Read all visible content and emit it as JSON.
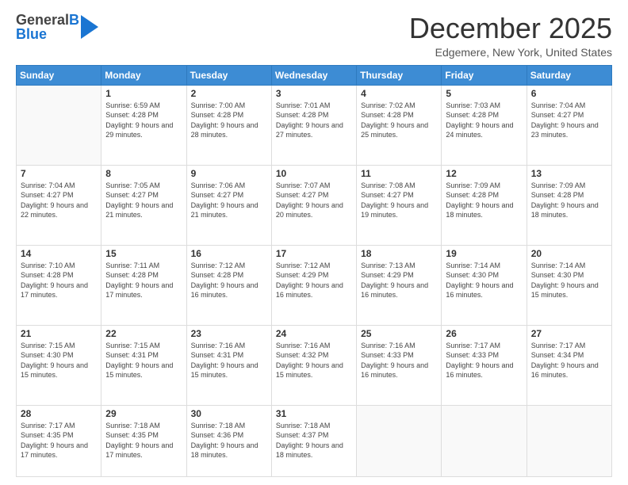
{
  "header": {
    "logo_line1_general": "General",
    "logo_line1_b": "B",
    "logo_line2": "Blue",
    "title": "December 2025",
    "subtitle": "Edgemere, New York, United States"
  },
  "calendar": {
    "days_of_week": [
      "Sunday",
      "Monday",
      "Tuesday",
      "Wednesday",
      "Thursday",
      "Friday",
      "Saturday"
    ],
    "weeks": [
      [
        {
          "day": "",
          "sunrise": "",
          "sunset": "",
          "daylight": ""
        },
        {
          "day": "1",
          "sunrise": "Sunrise: 6:59 AM",
          "sunset": "Sunset: 4:28 PM",
          "daylight": "Daylight: 9 hours and 29 minutes."
        },
        {
          "day": "2",
          "sunrise": "Sunrise: 7:00 AM",
          "sunset": "Sunset: 4:28 PM",
          "daylight": "Daylight: 9 hours and 28 minutes."
        },
        {
          "day": "3",
          "sunrise": "Sunrise: 7:01 AM",
          "sunset": "Sunset: 4:28 PM",
          "daylight": "Daylight: 9 hours and 27 minutes."
        },
        {
          "day": "4",
          "sunrise": "Sunrise: 7:02 AM",
          "sunset": "Sunset: 4:28 PM",
          "daylight": "Daylight: 9 hours and 25 minutes."
        },
        {
          "day": "5",
          "sunrise": "Sunrise: 7:03 AM",
          "sunset": "Sunset: 4:28 PM",
          "daylight": "Daylight: 9 hours and 24 minutes."
        },
        {
          "day": "6",
          "sunrise": "Sunrise: 7:04 AM",
          "sunset": "Sunset: 4:27 PM",
          "daylight": "Daylight: 9 hours and 23 minutes."
        }
      ],
      [
        {
          "day": "7",
          "sunrise": "Sunrise: 7:04 AM",
          "sunset": "Sunset: 4:27 PM",
          "daylight": "Daylight: 9 hours and 22 minutes."
        },
        {
          "day": "8",
          "sunrise": "Sunrise: 7:05 AM",
          "sunset": "Sunset: 4:27 PM",
          "daylight": "Daylight: 9 hours and 21 minutes."
        },
        {
          "day": "9",
          "sunrise": "Sunrise: 7:06 AM",
          "sunset": "Sunset: 4:27 PM",
          "daylight": "Daylight: 9 hours and 21 minutes."
        },
        {
          "day": "10",
          "sunrise": "Sunrise: 7:07 AM",
          "sunset": "Sunset: 4:27 PM",
          "daylight": "Daylight: 9 hours and 20 minutes."
        },
        {
          "day": "11",
          "sunrise": "Sunrise: 7:08 AM",
          "sunset": "Sunset: 4:27 PM",
          "daylight": "Daylight: 9 hours and 19 minutes."
        },
        {
          "day": "12",
          "sunrise": "Sunrise: 7:09 AM",
          "sunset": "Sunset: 4:28 PM",
          "daylight": "Daylight: 9 hours and 18 minutes."
        },
        {
          "day": "13",
          "sunrise": "Sunrise: 7:09 AM",
          "sunset": "Sunset: 4:28 PM",
          "daylight": "Daylight: 9 hours and 18 minutes."
        }
      ],
      [
        {
          "day": "14",
          "sunrise": "Sunrise: 7:10 AM",
          "sunset": "Sunset: 4:28 PM",
          "daylight": "Daylight: 9 hours and 17 minutes."
        },
        {
          "day": "15",
          "sunrise": "Sunrise: 7:11 AM",
          "sunset": "Sunset: 4:28 PM",
          "daylight": "Daylight: 9 hours and 17 minutes."
        },
        {
          "day": "16",
          "sunrise": "Sunrise: 7:12 AM",
          "sunset": "Sunset: 4:28 PM",
          "daylight": "Daylight: 9 hours and 16 minutes."
        },
        {
          "day": "17",
          "sunrise": "Sunrise: 7:12 AM",
          "sunset": "Sunset: 4:29 PM",
          "daylight": "Daylight: 9 hours and 16 minutes."
        },
        {
          "day": "18",
          "sunrise": "Sunrise: 7:13 AM",
          "sunset": "Sunset: 4:29 PM",
          "daylight": "Daylight: 9 hours and 16 minutes."
        },
        {
          "day": "19",
          "sunrise": "Sunrise: 7:14 AM",
          "sunset": "Sunset: 4:30 PM",
          "daylight": "Daylight: 9 hours and 16 minutes."
        },
        {
          "day": "20",
          "sunrise": "Sunrise: 7:14 AM",
          "sunset": "Sunset: 4:30 PM",
          "daylight": "Daylight: 9 hours and 15 minutes."
        }
      ],
      [
        {
          "day": "21",
          "sunrise": "Sunrise: 7:15 AM",
          "sunset": "Sunset: 4:30 PM",
          "daylight": "Daylight: 9 hours and 15 minutes."
        },
        {
          "day": "22",
          "sunrise": "Sunrise: 7:15 AM",
          "sunset": "Sunset: 4:31 PM",
          "daylight": "Daylight: 9 hours and 15 minutes."
        },
        {
          "day": "23",
          "sunrise": "Sunrise: 7:16 AM",
          "sunset": "Sunset: 4:31 PM",
          "daylight": "Daylight: 9 hours and 15 minutes."
        },
        {
          "day": "24",
          "sunrise": "Sunrise: 7:16 AM",
          "sunset": "Sunset: 4:32 PM",
          "daylight": "Daylight: 9 hours and 15 minutes."
        },
        {
          "day": "25",
          "sunrise": "Sunrise: 7:16 AM",
          "sunset": "Sunset: 4:33 PM",
          "daylight": "Daylight: 9 hours and 16 minutes."
        },
        {
          "day": "26",
          "sunrise": "Sunrise: 7:17 AM",
          "sunset": "Sunset: 4:33 PM",
          "daylight": "Daylight: 9 hours and 16 minutes."
        },
        {
          "day": "27",
          "sunrise": "Sunrise: 7:17 AM",
          "sunset": "Sunset: 4:34 PM",
          "daylight": "Daylight: 9 hours and 16 minutes."
        }
      ],
      [
        {
          "day": "28",
          "sunrise": "Sunrise: 7:17 AM",
          "sunset": "Sunset: 4:35 PM",
          "daylight": "Daylight: 9 hours and 17 minutes."
        },
        {
          "day": "29",
          "sunrise": "Sunrise: 7:18 AM",
          "sunset": "Sunset: 4:35 PM",
          "daylight": "Daylight: 9 hours and 17 minutes."
        },
        {
          "day": "30",
          "sunrise": "Sunrise: 7:18 AM",
          "sunset": "Sunset: 4:36 PM",
          "daylight": "Daylight: 9 hours and 18 minutes."
        },
        {
          "day": "31",
          "sunrise": "Sunrise: 7:18 AM",
          "sunset": "Sunset: 4:37 PM",
          "daylight": "Daylight: 9 hours and 18 minutes."
        },
        {
          "day": "",
          "sunrise": "",
          "sunset": "",
          "daylight": ""
        },
        {
          "day": "",
          "sunrise": "",
          "sunset": "",
          "daylight": ""
        },
        {
          "day": "",
          "sunrise": "",
          "sunset": "",
          "daylight": ""
        }
      ]
    ]
  }
}
